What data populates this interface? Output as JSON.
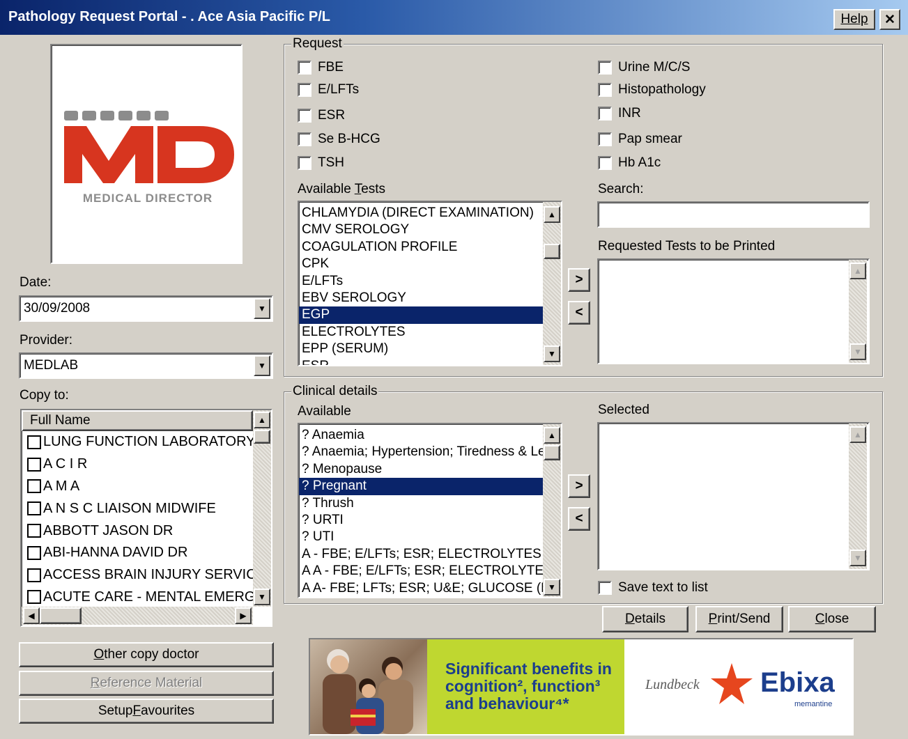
{
  "window": {
    "title": "Pathology Request Portal - . Ace Asia Pacific P/L",
    "help_label": "Help",
    "close_glyph": "✕"
  },
  "logo": {
    "brand_text": "MEDICAL DIRECTOR"
  },
  "date": {
    "label": "Date:",
    "value": "30/09/2008"
  },
  "provider": {
    "label": "Provider:",
    "value": "MEDLAB"
  },
  "copy_to": {
    "label": "Copy to:",
    "column_header": "Full Name",
    "items": [
      "LUNG FUNCTION LABORATORY SVI",
      "A C I R",
      "A M A",
      "A N S C  LIAISON MIDWIFE",
      "ABBOTT JASON DR",
      "ABI-HANNA DAVID DR",
      "ACCESS BRAIN INJURY SERVICES",
      "ACUTE CARE - MENTAL EMERGENC"
    ]
  },
  "buttons": {
    "other_copy_doctor": {
      "pre": "",
      "ul": "O",
      "post": "ther copy doctor"
    },
    "reference_material": {
      "pre": "",
      "ul": "R",
      "post": "eference Material"
    },
    "setup_favourites": {
      "pre": "Setup ",
      "ul": "F",
      "post": "avourites"
    },
    "details": {
      "pre": "",
      "ul": "D",
      "post": "etails"
    },
    "print_send": {
      "pre": "",
      "ul": "P",
      "post": "rint/Send"
    },
    "close": {
      "pre": "",
      "ul": "C",
      "post": "lose"
    }
  },
  "request": {
    "legend": "Request",
    "left_checks": [
      "FBE",
      "E/LFTs",
      "ESR",
      "Se B-HCG",
      "TSH"
    ],
    "right_checks": [
      "Urine M/C/S",
      "Histopathology",
      "INR",
      "Pap smear",
      "Hb A1c"
    ],
    "available_tests_label_pre": "Available ",
    "available_tests_label_ul": "T",
    "available_tests_label_post": "ests",
    "available_tests": [
      "CHLAMYDIA (DIRECT EXAMINATION)",
      "CMV SEROLOGY",
      "COAGULATION PROFILE",
      "CPK",
      "E/LFTs",
      "EBV SEROLOGY",
      "EGP",
      "ELECTROLYTES",
      "EPP (SERUM)",
      "ESR"
    ],
    "selected_test": "EGP",
    "search_label": "Search:",
    "search_value": "",
    "requested_label": "Requested Tests to be Printed",
    "add_glyph": ">",
    "remove_glyph": "<"
  },
  "clinical": {
    "legend": "Clinical details",
    "available_label": "Available",
    "selected_label": "Selected",
    "available_items": [
      "? Anaemia",
      "? Anaemia;  Hypertension;  Tiredness & Lethargy",
      "? Menopause",
      "? Pregnant",
      "? Thrush",
      "? URTI",
      "? UTI",
      "A  - FBE;  E/LFTs;  ESR;  ELECTROLYTES",
      "A A  - FBE;  E/LFTs;  ESR;  ELECTROLYTES",
      "A A- FBE; LFTs;  ESR; U&E;   GLUCOSE (FASTING)"
    ],
    "selected_item": "? Pregnant",
    "save_text_label": "Save text to list"
  },
  "ad": {
    "headline_line1": "Significant benefits in",
    "headline_line2": "cognition², function³",
    "headline_line3": "and behaviour⁴*",
    "brand_company": "Lundbeck",
    "brand_product": "Ebixa",
    "brand_generic": "memantine"
  },
  "colors": {
    "accent": "#0a246a",
    "ad_green": "#bfd730",
    "ad_text_blue": "#1c3e8c",
    "logo_red": "#d7351f"
  }
}
